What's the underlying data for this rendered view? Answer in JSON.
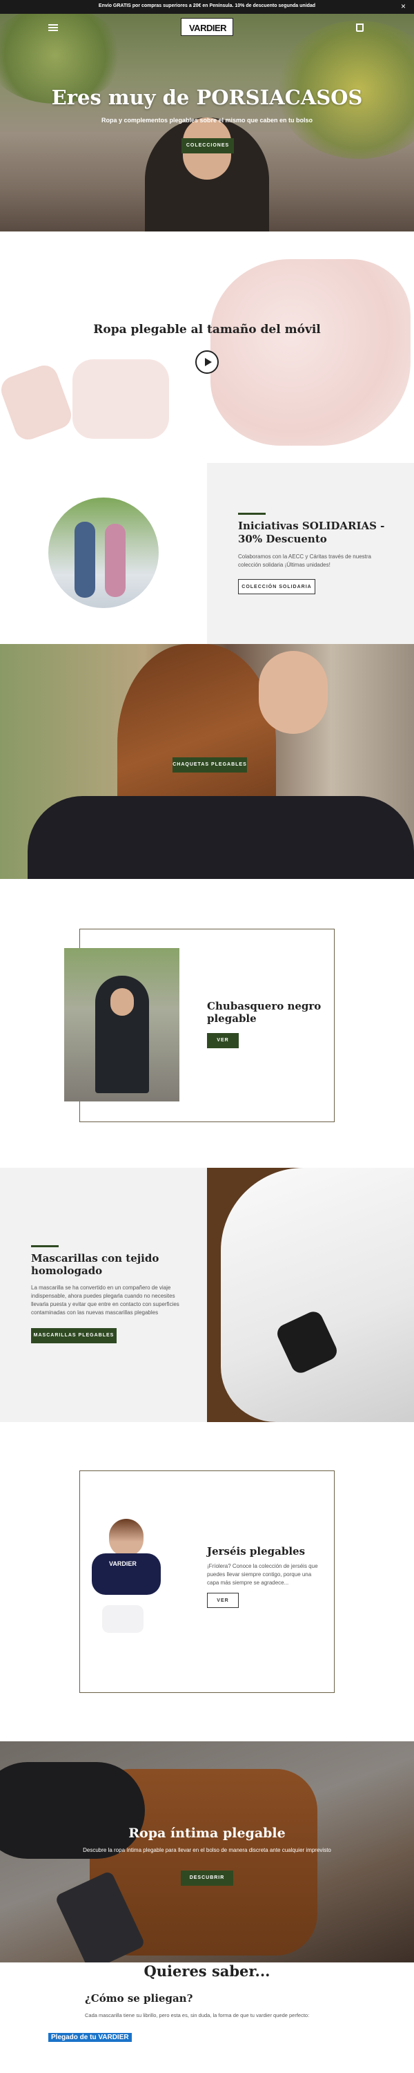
{
  "announcement": {
    "text": "Envío GRATIS por compras superiores a 20€ en Península. 10% de descuento segunda unidad",
    "close": "×"
  },
  "header": {
    "logo": "VARDIER"
  },
  "hero": {
    "title": "Eres muy de PORSIACASOS",
    "subtitle": "Ropa y complementos plegables sobre el mismo que caben en tu bolso",
    "button": "COLECCIONES"
  },
  "video": {
    "title": "Ropa plegable al tamaño del móvil"
  },
  "solidarias": {
    "title": "Iniciativas SOLIDARIAS - 30% Descuento",
    "text": "Colaboramos con la AECC y Cáritas través de nuestra colección solidaria ¡Últimas unidades!",
    "button": "COLECCIÓN SOLIDARIA"
  },
  "chaquetas": {
    "button": "CHAQUETAS PLEGABLES"
  },
  "chubasquero": {
    "title": "Chubasquero negro plegable",
    "button": "VER"
  },
  "mascarillas": {
    "title": "Mascarillas con tejido homologado",
    "text": "La mascarilla se ha convertido en un compañero de viaje indispensable, ahora puedes plegarla cuando no necesites llevarla puesta y evitar que entre en contacto con superficies contaminadas con las nuevas mascarillas plegables",
    "button": "MASCARILLAS PLEGABLES"
  },
  "jerseis": {
    "title": "Jerséis plegables",
    "text": "¡Fríolera? Conoce la colección de jerséis que puedes llevar siempre contigo, porque una capa más siempre se agradece...",
    "button": "VER",
    "product_label": "VARDIER"
  },
  "intima": {
    "title": "Ropa íntima plegable",
    "text": "Descubre la ropa íntima plegable para llevar en el bolso de manera discreta ante cualquier imprevisto",
    "button": "DESCUBRIR"
  },
  "faq": {
    "heading": "Quieres saber...",
    "question": "¿Cómo se pliegan?",
    "answer": "Cada mascarilla tiene su librillo, pero esta es, sin duda, la forma de que tu vardier quede perfecto:",
    "link": "Plegado de tu VARDIER"
  },
  "colors": {
    "accent": "#2f4a22",
    "link_bg": "#1a73c9"
  }
}
